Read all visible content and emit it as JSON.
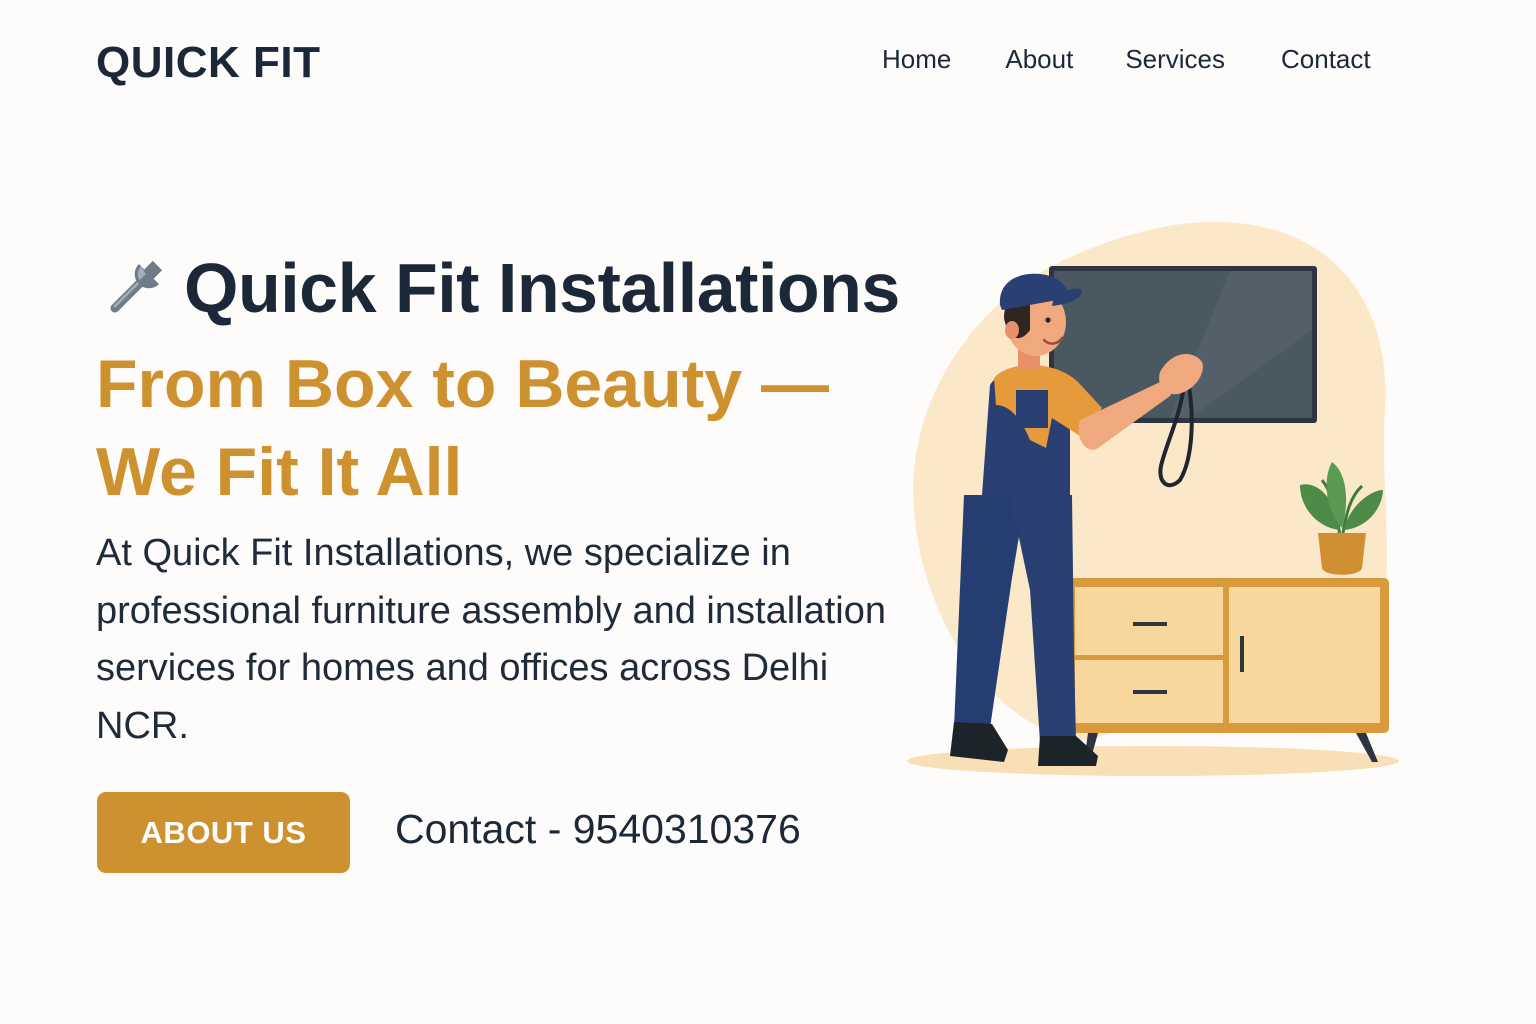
{
  "header": {
    "logo": "QUICK FIT",
    "nav": [
      "Home",
      "About",
      "Services",
      "Contact"
    ]
  },
  "hero": {
    "title": "Quick Fit Installations",
    "title_icon": "wrench-icon",
    "tagline": "From Box to Beauty — We Fit It All",
    "description": "At Quick Fit Installations, we specialize in professional furniture assembly and installation services for homes and offices across Delhi NCR.",
    "cta_label": "ABOUT US",
    "contact_text": "Contact - 9540310376"
  },
  "illustration": {
    "subject": "installer-mounting-tv-illustration"
  },
  "colors": {
    "accent": "#cd9130",
    "text_dark": "#1c2838",
    "background": "#fdfcfa",
    "blob": "#fbe8c8",
    "overalls": "#2a4073"
  }
}
